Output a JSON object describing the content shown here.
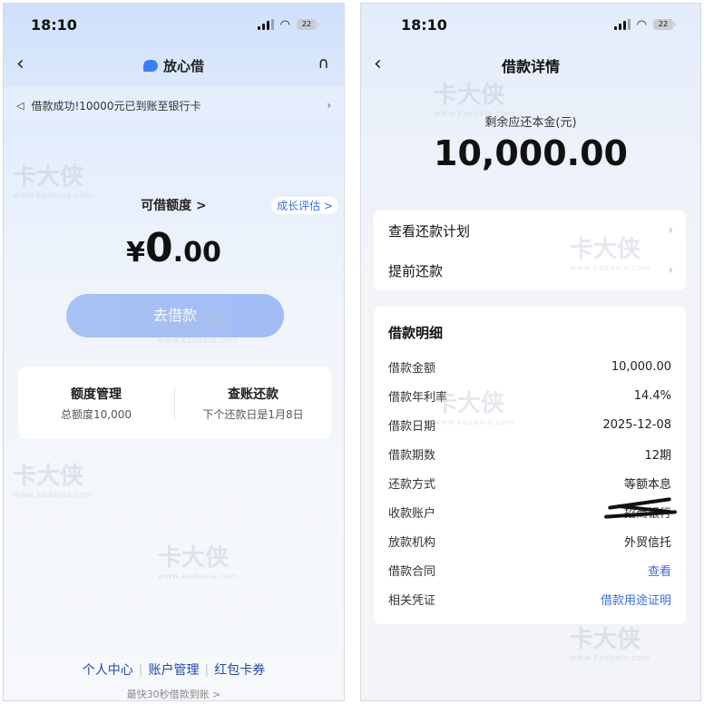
{
  "status_bar": {
    "time": "18:10",
    "battery": "22"
  },
  "left": {
    "app_name": "放心借",
    "notice": "借款成功!10000元已到账至银行卡",
    "limit_label": "可借额度 >",
    "growth_badge": "成长评估 >",
    "amount": {
      "currency": "¥",
      "integer": "0",
      "decimal": ".00"
    },
    "borrow_button": "去借款",
    "quota": {
      "title": "额度管理",
      "subtitle": "总额度10,000"
    },
    "repay": {
      "title": "查账还款",
      "subtitle": "下个还款日是1月8日"
    },
    "links": [
      "个人中心",
      "账户管理",
      "红包卡券"
    ],
    "tagline": "最快30秒借款到账 >"
  },
  "right": {
    "title": "借款详情",
    "remaining_label": "剩余应还本金(元)",
    "remaining_amount": "10,000.00",
    "menu": [
      "查看还款计划",
      "提前还款"
    ],
    "detail_title": "借款明细",
    "rows": [
      {
        "label": "借款金额",
        "value": "10,000.00"
      },
      {
        "label": "借款年利率",
        "value": "14.4%"
      },
      {
        "label": "借款日期",
        "value": "2025-12-08"
      },
      {
        "label": "借款期数",
        "value": "12期"
      },
      {
        "label": "还款方式",
        "value": "等额本息"
      },
      {
        "label": "收款账户",
        "value": "招商银行"
      },
      {
        "label": "放款机构",
        "value": "外贸信托"
      },
      {
        "label": "借款合同",
        "value": "查看"
      },
      {
        "label": "相关凭证",
        "value": "借款用途证明"
      }
    ]
  },
  "watermark": {
    "text": "卡大侠",
    "url": "www.kadaxia.com"
  },
  "colors": {
    "accent": "#3a6fe0",
    "button": "#a8c2f5",
    "link": "#234aa8"
  }
}
